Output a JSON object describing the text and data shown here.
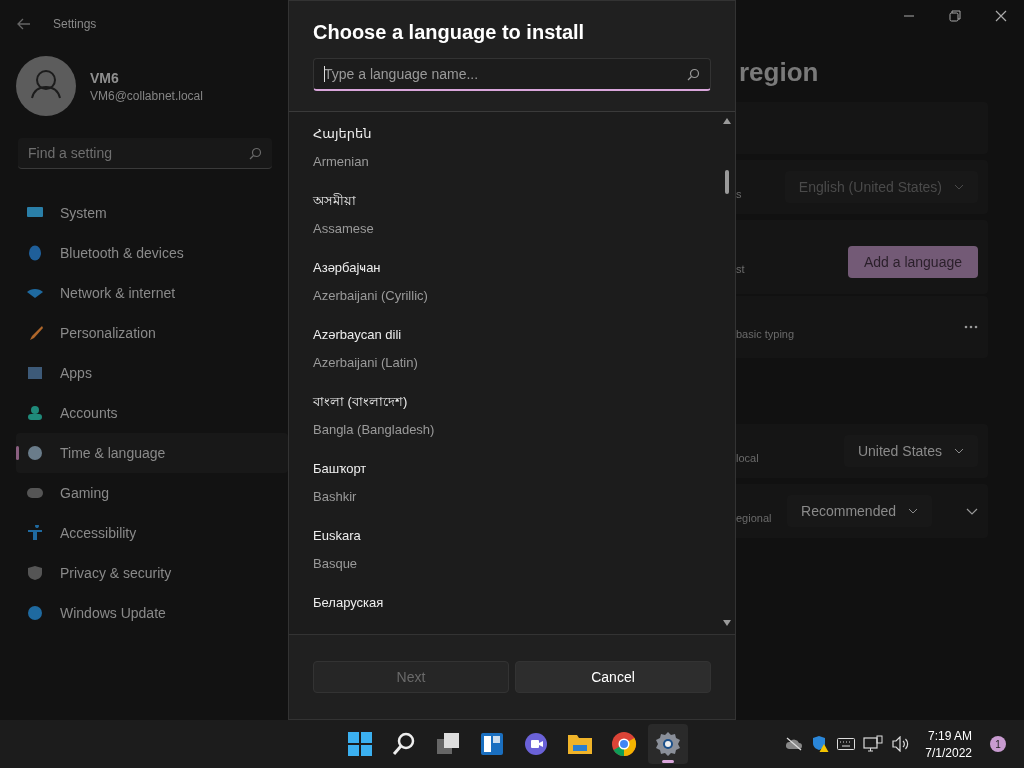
{
  "settings_window": {
    "title": "Settings",
    "user": {
      "name": "VM6",
      "email": "VM6@collabnet.local"
    },
    "search": {
      "placeholder": "Find a setting"
    },
    "nav_items": [
      {
        "label": "System",
        "selected": false
      },
      {
        "label": "Bluetooth & devices",
        "selected": false
      },
      {
        "label": "Network & internet",
        "selected": false
      },
      {
        "label": "Personalization",
        "selected": false
      },
      {
        "label": "Apps",
        "selected": false
      },
      {
        "label": "Accounts",
        "selected": false
      },
      {
        "label": "Time & language",
        "selected": true
      },
      {
        "label": "Gaming",
        "selected": false
      },
      {
        "label": "Accessibility",
        "selected": false
      },
      {
        "label": "Privacy & security",
        "selected": false
      },
      {
        "label": "Windows Update",
        "selected": false
      }
    ],
    "page_title": "region",
    "rows": [
      {
        "kind": "dropdown",
        "label": "s",
        "value": "English (United States)",
        "disabled": true
      },
      {
        "kind": "button",
        "label": "st",
        "value": "Add a language"
      },
      {
        "kind": "more",
        "label": "basic typing"
      },
      {
        "kind": "dropdown",
        "label": "local",
        "value": "United States",
        "disabled": false
      },
      {
        "kind": "expander",
        "label": "egional",
        "value": "Recommended",
        "disabled": false
      }
    ]
  },
  "dialog": {
    "title": "Choose a language to install",
    "search": {
      "placeholder": "Type a language name..."
    },
    "languages": [
      {
        "native": "Հայերեն",
        "english": "Armenian"
      },
      {
        "native": "অসমীয়া",
        "english": "Assamese"
      },
      {
        "native": "Азәрбајҹан",
        "english": "Azerbaijani (Cyrillic)"
      },
      {
        "native": "Azərbaycan dili",
        "english": "Azerbaijani (Latin)"
      },
      {
        "native": "বাংলা (বাংলাদেশ)",
        "english": "Bangla (Bangladesh)"
      },
      {
        "native": "Башҡорт",
        "english": "Bashkir"
      },
      {
        "native": "Euskara",
        "english": "Basque"
      },
      {
        "native": "Беларуская"
      }
    ],
    "buttons": [
      {
        "label": "Next",
        "disabled": true
      },
      {
        "label": "Cancel",
        "disabled": false
      }
    ]
  },
  "taskbar": {
    "apps": [
      {
        "selected": false
      },
      {
        "selected": false
      },
      {
        "selected": false
      },
      {
        "selected": false
      },
      {
        "selected": false
      },
      {
        "selected": false
      },
      {
        "selected": false
      },
      {
        "selected": true
      }
    ],
    "time": "7:19 AM",
    "date": "7/1/2022",
    "notifications": "1"
  }
}
